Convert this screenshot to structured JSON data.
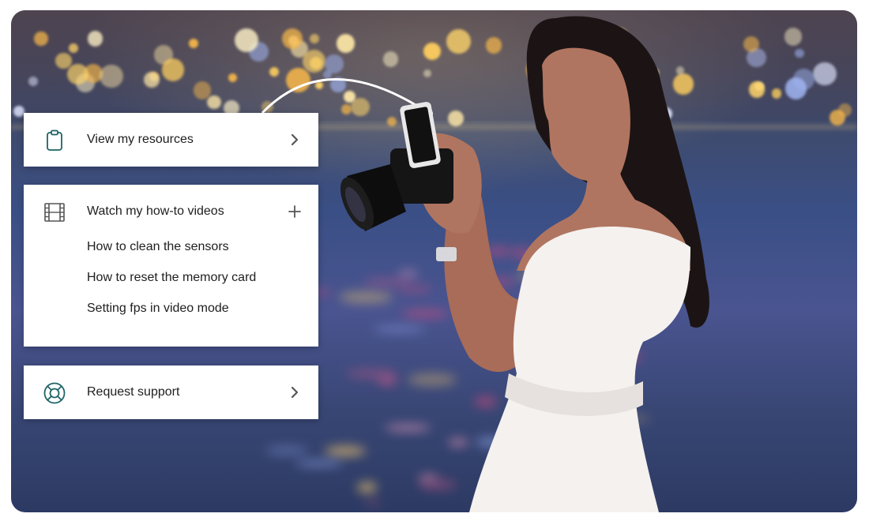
{
  "cards": [
    {
      "title": "View my resources",
      "icon": "clipboard-icon",
      "action": "chevron-right-icon"
    },
    {
      "title": "Watch my how-to videos",
      "icon": "film-icon",
      "action": "plus-icon",
      "items": [
        "How to clean the sensors",
        "How to reset the memory card",
        "Setting fps in video mode"
      ]
    },
    {
      "title": "Request support",
      "icon": "lifebuoy-icon",
      "action": "chevron-right-icon"
    }
  ],
  "colors": {
    "icon": "#1f6466",
    "text": "#1e1e1e",
    "chevron": "#555555"
  }
}
